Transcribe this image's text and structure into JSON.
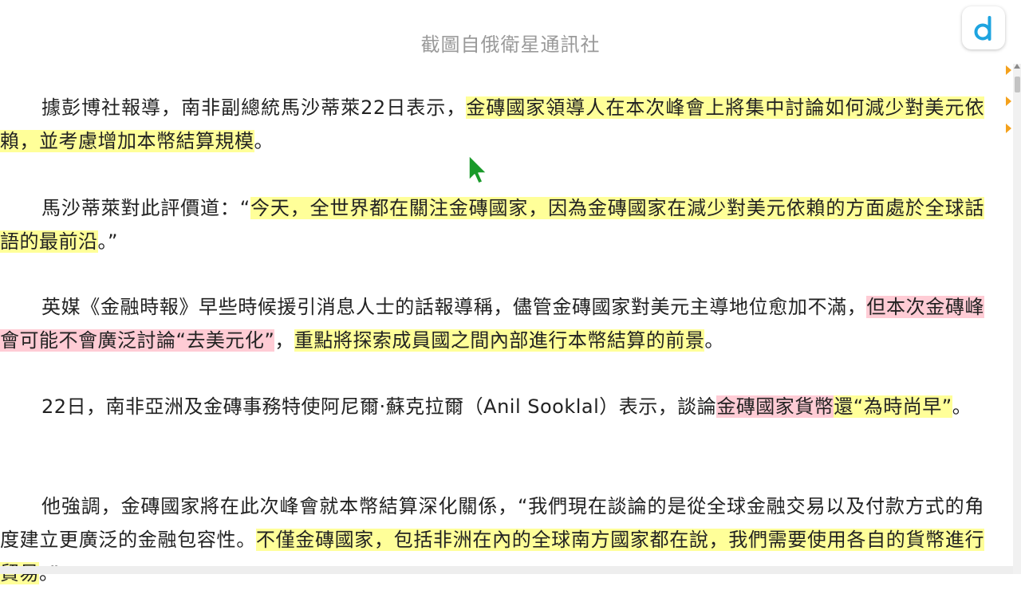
{
  "caption": "截圖自俄衛星通訊社",
  "paragraphs": [
    {
      "segments": [
        {
          "text": "據彭博社報導，南非副總統馬沙蒂萊22日表示，",
          "hl": ""
        },
        {
          "text": "金磚國家領導人在本次峰會上將集中討論如何減少對美元依賴，並考慮增加本幣結算規模",
          "hl": "yellow"
        },
        {
          "text": "。",
          "hl": ""
        }
      ]
    },
    {
      "segments": [
        {
          "text": "馬沙蒂萊對此評價道：“",
          "hl": ""
        },
        {
          "text": "今天，全世界都在關注金磚國家，因為金磚國家在減少對美元依賴的方面處於全球話語的最前沿",
          "hl": "yellow"
        },
        {
          "text": "。”",
          "hl": ""
        }
      ]
    },
    {
      "segments": [
        {
          "text": "英媒《金融時報》早些時候援引消息人士的話報導稱，儘管金磚國家對美元主導地位愈加不滿，",
          "hl": ""
        },
        {
          "text": "但本次金磚峰會可能不會廣泛討論“去美元化”",
          "hl": "pink"
        },
        {
          "text": "，",
          "hl": ""
        },
        {
          "text": "重點將探索成員國之間內部進行本幣結算的前景",
          "hl": "yellow"
        },
        {
          "text": "。",
          "hl": ""
        }
      ]
    },
    {
      "segments": [
        {
          "text": "22日，南非亞洲及金磚事務特使阿尼爾·蘇克拉爾（Anil Sooklal）表示，談論",
          "hl": ""
        },
        {
          "text": "金磚國家貨幣",
          "hl": "pink"
        },
        {
          "text": "還“為時尚早”",
          "hl": "yellow"
        },
        {
          "text": "。",
          "hl": ""
        }
      ]
    },
    {
      "segments": [
        {
          "text": "他強調，金磚國家將在此次峰會就本幣結算深化關係，“我們現在談論的是從全球金融交易以及付款方式的角度建立更廣泛的金融包容性。",
          "hl": ""
        },
        {
          "text": "不僅金磚國家，包括非洲在內的全球南方國家都在說，我們需要使用各自的貨幣進行貿易",
          "hl": "yellow"
        },
        {
          "text": "。”",
          "hl": ""
        }
      ]
    }
  ],
  "logo_letter": "d",
  "colors": {
    "highlight_yellow": "#ffff99",
    "highlight_pink": "#ffccd5",
    "caption": "#9a9a9a",
    "logo_accent": "#1ea4e0",
    "cursor": "#1a9a2a",
    "marker": "#f4a11c"
  },
  "icons": {
    "logo": "d-logo-icon",
    "cursor": "pointer-cursor-icon",
    "markers": "triangle-marker-icon"
  }
}
